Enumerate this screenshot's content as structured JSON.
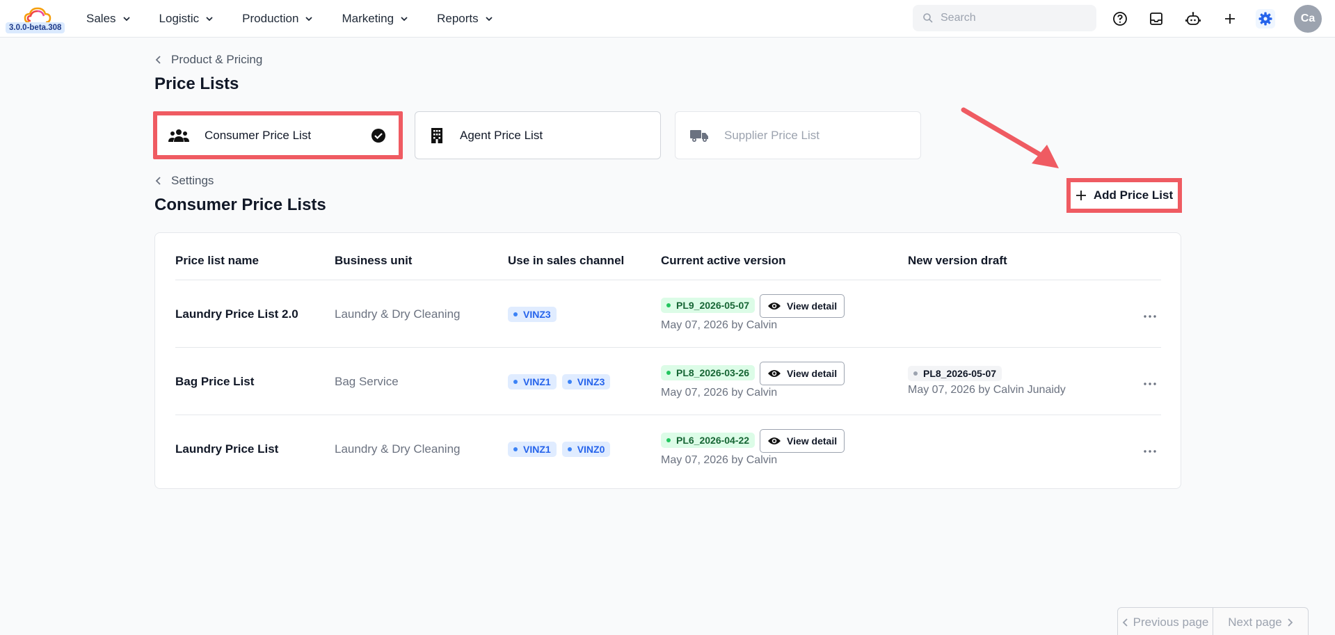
{
  "app": {
    "version": "3.0.0-beta.308"
  },
  "nav": {
    "items": [
      {
        "label": "Sales"
      },
      {
        "label": "Logistic"
      },
      {
        "label": "Production"
      },
      {
        "label": "Marketing"
      },
      {
        "label": "Reports"
      }
    ]
  },
  "search": {
    "placeholder": "Search"
  },
  "toolbar_icons": [
    "help-icon",
    "inbox-icon",
    "robot-icon",
    "plus-icon",
    "gear-icon"
  ],
  "user": {
    "initials": "Ca"
  },
  "breadcrumb_top": {
    "label": "Product & Pricing"
  },
  "page_title": "Price Lists",
  "tabs": [
    {
      "label": "Consumer Price List",
      "icon": "users-icon",
      "state": "active"
    },
    {
      "label": "Agent Price List",
      "icon": "building-icon",
      "state": "normal"
    },
    {
      "label": "Supplier Price List",
      "icon": "truck-icon",
      "state": "disabled"
    }
  ],
  "breadcrumb_settings": {
    "label": "Settings"
  },
  "section_title": "Consumer Price Lists",
  "add_button": {
    "label": "Add Price List"
  },
  "table": {
    "columns": [
      "Price list name",
      "Business unit",
      "Use in sales channel",
      "Current active version",
      "New version draft"
    ],
    "rows": [
      {
        "name": "Laundry Price List 2.0",
        "business_unit": "Laundry & Dry Cleaning",
        "channels": [
          "VINZ3"
        ],
        "active_version": "PL9_2026-05-07",
        "active_meta": "May 07, 2026 by Calvin",
        "view_label": "View detail",
        "draft_version": "",
        "draft_meta": ""
      },
      {
        "name": "Bag Price List",
        "business_unit": "Bag Service",
        "channels": [
          "VINZ1",
          "VINZ3"
        ],
        "active_version": "PL8_2026-03-26",
        "active_meta": "May 07, 2026 by Calvin",
        "view_label": "View detail",
        "draft_version": "PL8_2026-05-07",
        "draft_meta": "May 07, 2026 by Calvin Junaidy"
      },
      {
        "name": "Laundry Price List",
        "business_unit": "Laundry & Dry Cleaning",
        "channels": [
          "VINZ1",
          "VINZ0"
        ],
        "active_version": "PL6_2026-04-22",
        "active_meta": "May 07, 2026 by Calvin",
        "view_label": "View detail",
        "draft_version": "",
        "draft_meta": ""
      }
    ]
  },
  "pagination": {
    "prev_label": "Previous page",
    "next_label": "Next page"
  },
  "colors": {
    "highlight": "#ef5b62",
    "accent": "#2563eb"
  }
}
